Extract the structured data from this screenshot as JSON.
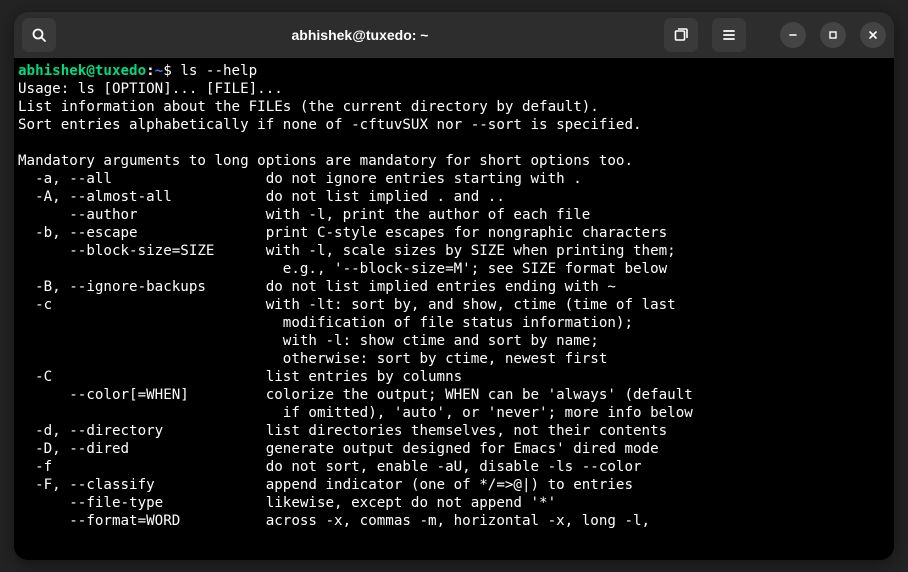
{
  "titlebar": {
    "title": "abhishek@tuxedo: ~"
  },
  "prompt": {
    "user_host": "abhishek@tuxedo",
    "path": "~",
    "symbol": "$",
    "command": "ls --help"
  },
  "output": {
    "usage": "Usage: ls [OPTION]... [FILE]...",
    "desc1": "List information about the FILEs (the current directory by default).",
    "desc2": "Sort entries alphabetically if none of -cftuvSUX nor --sort is specified.",
    "mandatory": "Mandatory arguments to long options are mandatory for short options too.",
    "opts": {
      "a": "  -a, --all                  do not ignore entries starting with .",
      "A": "  -A, --almost-all           do not list implied . and ..",
      "author": "      --author               with -l, print the author of each file",
      "b": "  -b, --escape               print C-style escapes for nongraphic characters",
      "block1": "      --block-size=SIZE      with -l, scale sizes by SIZE when printing them;",
      "block2": "                               e.g., '--block-size=M'; see SIZE format below",
      "B": "  -B, --ignore-backups       do not list implied entries ending with ~",
      "c1": "  -c                         with -lt: sort by, and show, ctime (time of last",
      "c2": "                               modification of file status information);",
      "c3": "                               with -l: show ctime and sort by name;",
      "c4": "                               otherwise: sort by ctime, newest first",
      "C": "  -C                         list entries by columns",
      "color1": "      --color[=WHEN]         colorize the output; WHEN can be 'always' (default",
      "color2": "                               if omitted), 'auto', or 'never'; more info below",
      "d": "  -d, --directory            list directories themselves, not their contents",
      "D": "  -D, --dired                generate output designed for Emacs' dired mode",
      "f": "  -f                         do not sort, enable -aU, disable -ls --color",
      "F": "  -F, --classify             append indicator (one of */=>@|) to entries",
      "ftype": "      --file-type            likewise, except do not append '*'",
      "format": "      --format=WORD          across -x, commas -m, horizontal -x, long -l,"
    }
  }
}
